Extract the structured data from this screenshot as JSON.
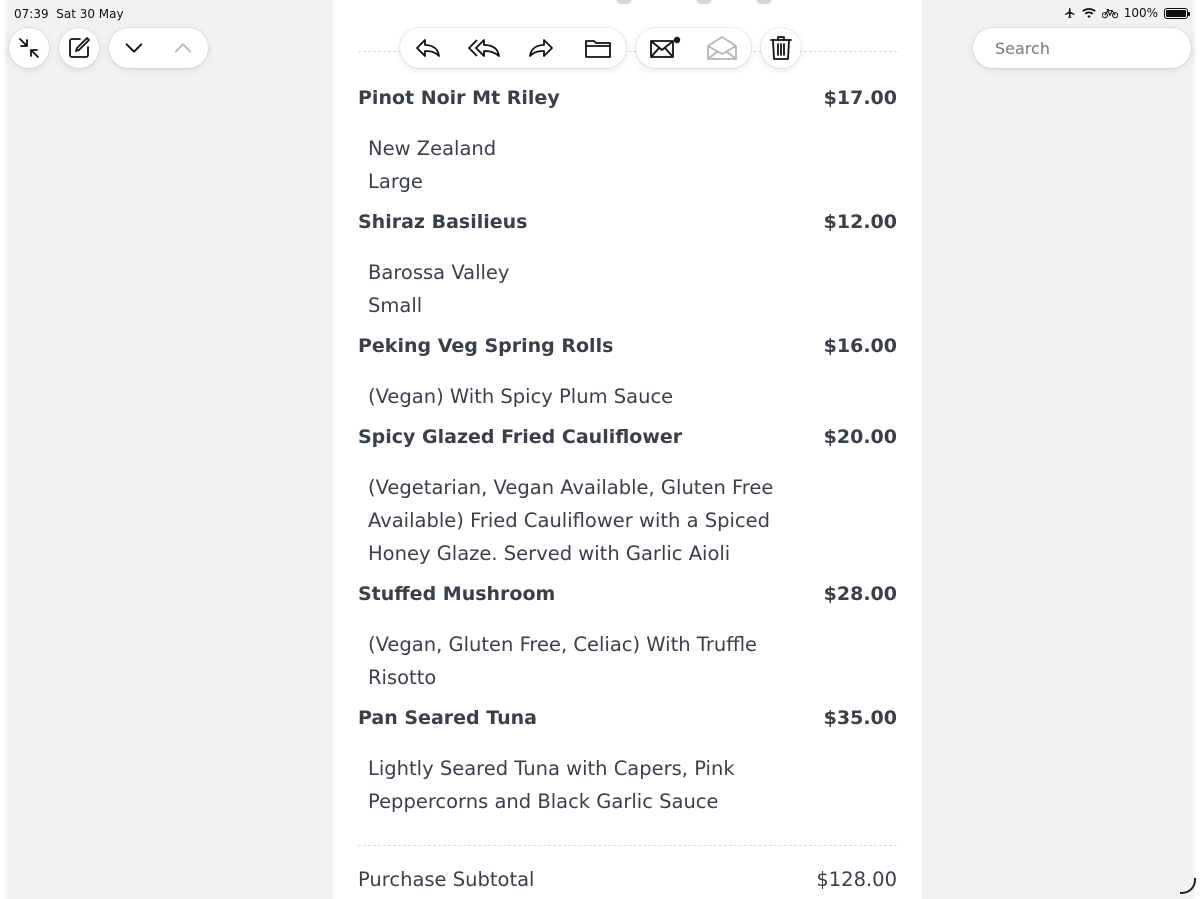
{
  "status_bar": {
    "time": "07:39",
    "date": "Sat 30 May",
    "battery": "100%"
  },
  "toolbar": {
    "icons": {
      "collapse": "arrows-collapse-icon",
      "compose": "compose-icon",
      "next": "chevron-down-icon",
      "previous": "chevron-up-icon",
      "reply": "reply-icon",
      "reply_all": "reply-all-icon",
      "forward": "forward-icon",
      "move": "folder-icon",
      "mark_unread": "envelope-unread-icon",
      "mark_read": "envelope-open-icon",
      "trash": "trash-icon"
    }
  },
  "search": {
    "placeholder": "Search"
  },
  "receipt": {
    "items": [
      {
        "name": "Pinot Noir Mt Riley",
        "price": "$17.00",
        "lines": [
          "New Zealand",
          "Large"
        ]
      },
      {
        "name": "Shiraz Basilieus",
        "price": "$12.00",
        "lines": [
          "Barossa Valley",
          "Small"
        ]
      },
      {
        "name": "Peking Veg Spring Rolls",
        "price": "$16.00",
        "lines": [
          "(Vegan) With Spicy Plum Sauce"
        ]
      },
      {
        "name": "Spicy Glazed Fried Cauliflower",
        "price": "$20.00",
        "lines": [
          "(Vegetarian, Vegan Available, Gluten Free",
          "Available) Fried Cauliflower with a Spiced",
          "Honey Glaze. Served with Garlic Aioli"
        ]
      },
      {
        "name": "Stuffed Mushroom",
        "price": "$28.00",
        "lines": [
          "(Vegan, Gluten Free, Celiac) With Truffle",
          "Risotto"
        ]
      },
      {
        "name": "Pan Seared Tuna",
        "price": "$35.00",
        "lines": [
          "Lightly Seared Tuna with Capers, Pink",
          "Peppercorns and Black Garlic Sauce"
        ]
      }
    ],
    "subtotal_label": "Purchase Subtotal",
    "subtotal_value": "$128.00"
  },
  "colors": {
    "text": "#3a4047",
    "background": "#f2f2f4",
    "card": "#ffffff"
  }
}
